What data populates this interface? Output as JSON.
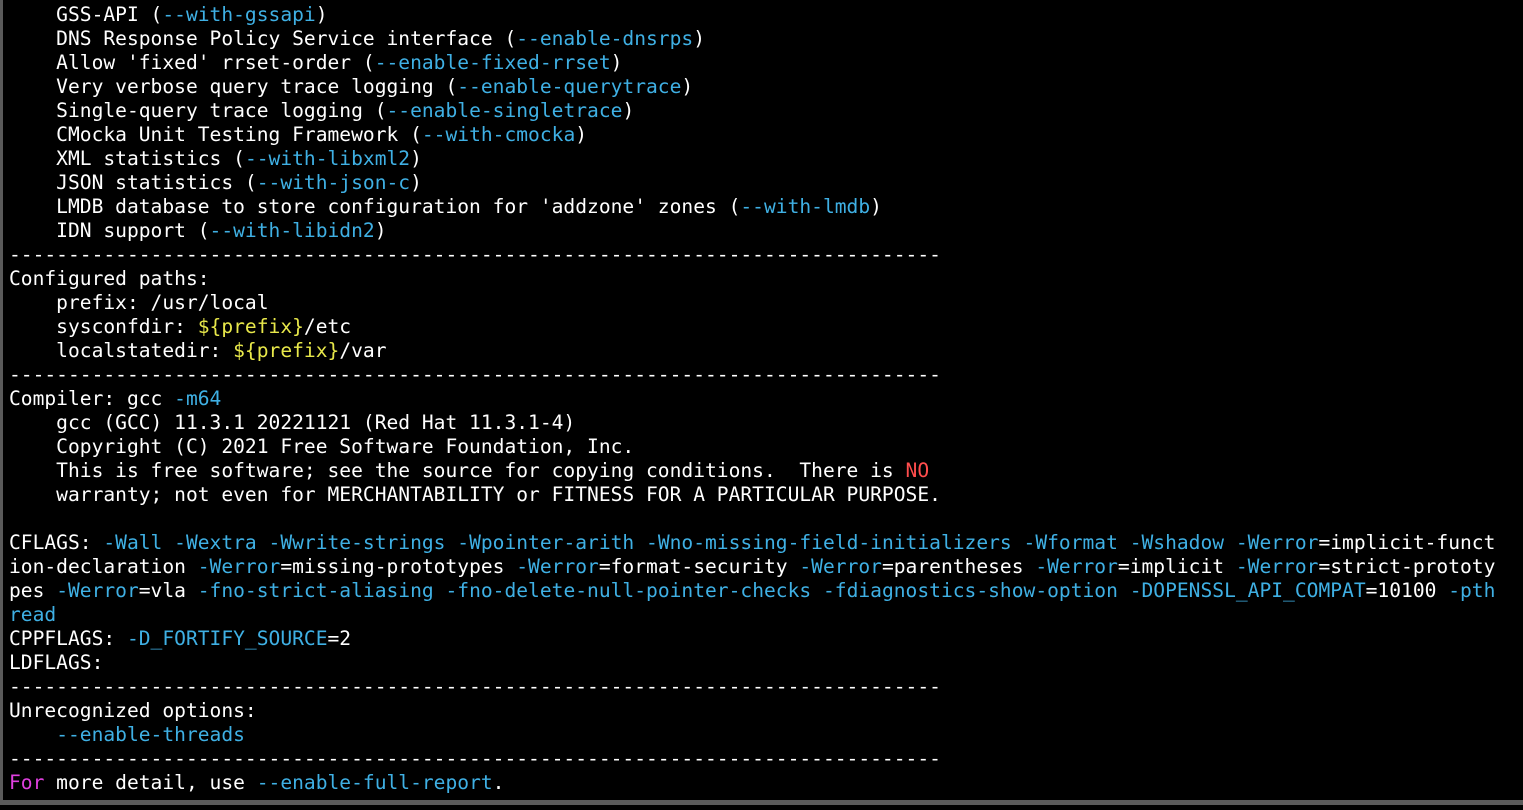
{
  "palette": {
    "background": "#000000",
    "text": "#ffffff",
    "option": "#3fb0e4",
    "variable": "#e8e84a",
    "warning": "#ff4d4d",
    "keyword": "#e040e0"
  },
  "terminal": {
    "lines": [
      [
        {
          "t": "    GSS-API ("
        },
        {
          "t": "--with-gssapi",
          "c": "option"
        },
        {
          "t": ")"
        }
      ],
      [
        {
          "t": "    DNS Response Policy Service interface ("
        },
        {
          "t": "--enable-dnsrps",
          "c": "option"
        },
        {
          "t": ")"
        }
      ],
      [
        {
          "t": "    Allow 'fixed' rrset-order ("
        },
        {
          "t": "--enable-fixed-rrset",
          "c": "option"
        },
        {
          "t": ")"
        }
      ],
      [
        {
          "t": "    Very verbose query trace logging ("
        },
        {
          "t": "--enable-querytrace",
          "c": "option"
        },
        {
          "t": ")"
        }
      ],
      [
        {
          "t": "    Single-query trace logging ("
        },
        {
          "t": "--enable-singletrace",
          "c": "option"
        },
        {
          "t": ")"
        }
      ],
      [
        {
          "t": "    CMocka Unit Testing Framework ("
        },
        {
          "t": "--with-cmocka",
          "c": "option"
        },
        {
          "t": ")"
        }
      ],
      [
        {
          "t": "    XML statistics ("
        },
        {
          "t": "--with-libxml2",
          "c": "option"
        },
        {
          "t": ")"
        }
      ],
      [
        {
          "t": "    JSON statistics ("
        },
        {
          "t": "--with-json-c",
          "c": "option"
        },
        {
          "t": ")"
        }
      ],
      [
        {
          "t": "    LMDB database to store configuration for 'addzone' zones ("
        },
        {
          "t": "--with-lmdb",
          "c": "option"
        },
        {
          "t": ")"
        }
      ],
      [
        {
          "t": "    IDN support ("
        },
        {
          "t": "--with-libidn2",
          "c": "option"
        },
        {
          "t": ")"
        }
      ],
      [
        {
          "t": "-------------------------------------------------------------------------------"
        }
      ],
      [
        {
          "t": "Configured paths:"
        }
      ],
      [
        {
          "t": "    prefix: /usr/local"
        }
      ],
      [
        {
          "t": "    sysconfdir: "
        },
        {
          "t": "${prefix}",
          "c": "variable"
        },
        {
          "t": "/etc"
        }
      ],
      [
        {
          "t": "    localstatedir: "
        },
        {
          "t": "${prefix}",
          "c": "variable"
        },
        {
          "t": "/var"
        }
      ],
      [
        {
          "t": "-------------------------------------------------------------------------------"
        }
      ],
      [
        {
          "t": "Compiler: gcc "
        },
        {
          "t": "-m64",
          "c": "option"
        }
      ],
      [
        {
          "t": "    gcc (GCC) 11.3.1 20221121 (Red Hat 11.3.1-4)"
        }
      ],
      [
        {
          "t": "    Copyright (C) 2021 Free Software Foundation, Inc."
        }
      ],
      [
        {
          "t": "    This is free software; see the source for copying conditions.  There is "
        },
        {
          "t": "NO",
          "c": "warning"
        }
      ],
      [
        {
          "t": "    warranty; not even for MERCHANTABILITY or FITNESS FOR A PARTICULAR PURPOSE."
        }
      ],
      [
        {
          "t": ""
        }
      ],
      [
        {
          "t": "CFLAGS: "
        },
        {
          "t": "-Wall",
          "c": "option"
        },
        {
          "t": " "
        },
        {
          "t": "-Wextra",
          "c": "option"
        },
        {
          "t": " "
        },
        {
          "t": "-Wwrite-strings",
          "c": "option"
        },
        {
          "t": " "
        },
        {
          "t": "-Wpointer-arith",
          "c": "option"
        },
        {
          "t": " "
        },
        {
          "t": "-Wno-missing-field-initializers",
          "c": "option"
        },
        {
          "t": " "
        },
        {
          "t": "-Wformat",
          "c": "option"
        },
        {
          "t": " "
        },
        {
          "t": "-Wshadow",
          "c": "option"
        },
        {
          "t": " "
        },
        {
          "t": "-Werror",
          "c": "option"
        },
        {
          "t": "=implicit-funct"
        }
      ],
      [
        {
          "t": "ion-declaration "
        },
        {
          "t": "-Werror",
          "c": "option"
        },
        {
          "t": "=missing-prototypes "
        },
        {
          "t": "-Werror",
          "c": "option"
        },
        {
          "t": "=format-security "
        },
        {
          "t": "-Werror",
          "c": "option"
        },
        {
          "t": "=parentheses "
        },
        {
          "t": "-Werror",
          "c": "option"
        },
        {
          "t": "=implicit "
        },
        {
          "t": "-Werror",
          "c": "option"
        },
        {
          "t": "=strict-prototy"
        }
      ],
      [
        {
          "t": "pes "
        },
        {
          "t": "-Werror",
          "c": "option"
        },
        {
          "t": "=vla "
        },
        {
          "t": "-fno-strict-aliasing",
          "c": "option"
        },
        {
          "t": " "
        },
        {
          "t": "-fno-delete-null-pointer-checks",
          "c": "option"
        },
        {
          "t": " "
        },
        {
          "t": "-fdiagnostics-show-option",
          "c": "option"
        },
        {
          "t": " "
        },
        {
          "t": "-DOPENSSL_API_COMPAT",
          "c": "option"
        },
        {
          "t": "=10100 "
        },
        {
          "t": "-pth",
          "c": "option"
        }
      ],
      [
        {
          "t": "read",
          "c": "option"
        }
      ],
      [
        {
          "t": "CPPFLAGS: "
        },
        {
          "t": "-D_FORTIFY_SOURCE",
          "c": "option"
        },
        {
          "t": "=2"
        }
      ],
      [
        {
          "t": "LDFLAGS:"
        }
      ],
      [
        {
          "t": "-------------------------------------------------------------------------------"
        }
      ],
      [
        {
          "t": "Unrecognized options:"
        }
      ],
      [
        {
          "t": "    "
        },
        {
          "t": "--enable-threads",
          "c": "option"
        }
      ],
      [
        {
          "t": "-------------------------------------------------------------------------------"
        }
      ],
      [
        {
          "t": "For",
          "c": "keyword"
        },
        {
          "t": " more detail, use "
        },
        {
          "t": "--enable-full-report",
          "c": "option"
        },
        {
          "t": "."
        }
      ]
    ]
  }
}
